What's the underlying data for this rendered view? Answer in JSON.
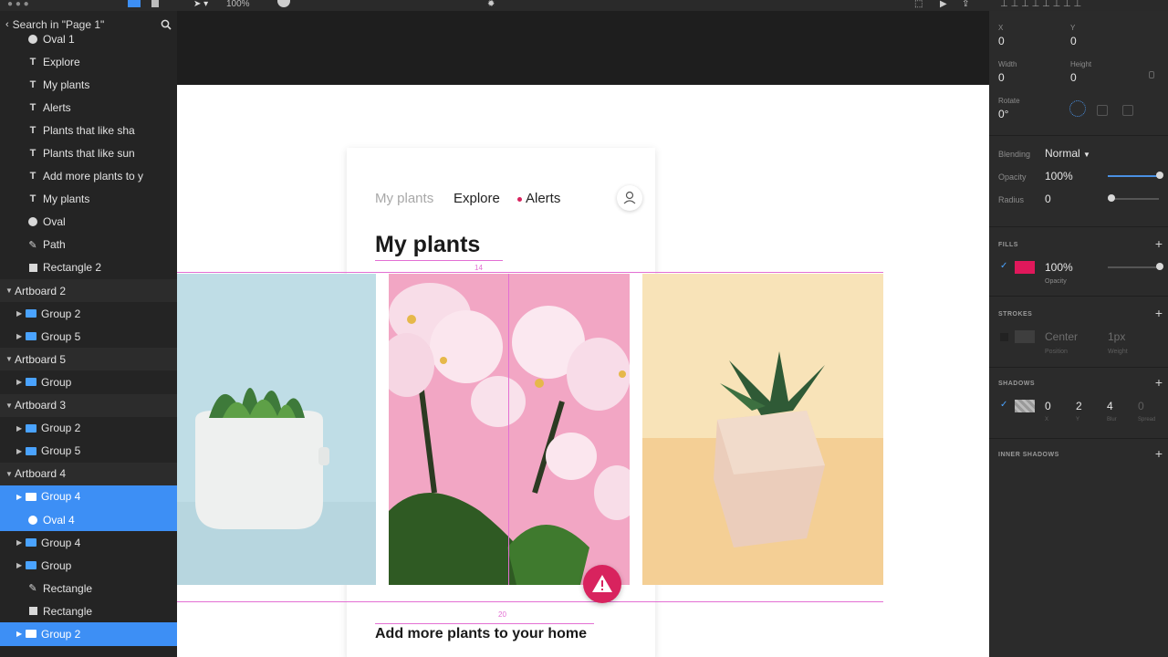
{
  "layers_panel": {
    "search_label": "Search in \"Page 1\"",
    "items": [
      {
        "label": "Oval 1",
        "type": "oval",
        "indent": 1
      },
      {
        "label": "Explore",
        "type": "text",
        "indent": 1
      },
      {
        "label": "My plants",
        "type": "text",
        "indent": 1
      },
      {
        "label": "Alerts",
        "type": "text",
        "indent": 1
      },
      {
        "label": "Plants that like sha",
        "type": "text",
        "indent": 1
      },
      {
        "label": "Plants that like sun",
        "type": "text",
        "indent": 1
      },
      {
        "label": "Add more plants to y",
        "type": "text",
        "indent": 1
      },
      {
        "label": "My plants",
        "type": "text",
        "indent": 1
      },
      {
        "label": "Oval",
        "type": "oval",
        "indent": 1
      },
      {
        "label": "Path",
        "type": "path",
        "indent": 1
      },
      {
        "label": "Rectangle 2",
        "type": "rect",
        "indent": 1
      },
      {
        "label": "Artboard 2",
        "type": "artboard",
        "indent": 0
      },
      {
        "label": "Group 2",
        "type": "group",
        "indent": 1
      },
      {
        "label": "Group 5",
        "type": "group",
        "indent": 1
      },
      {
        "label": "Artboard 5",
        "type": "artboard",
        "indent": 0
      },
      {
        "label": "Group",
        "type": "group",
        "indent": 1
      },
      {
        "label": "Artboard 3",
        "type": "artboard",
        "indent": 0
      },
      {
        "label": "Group 2",
        "type": "group",
        "indent": 1
      },
      {
        "label": "Group 5",
        "type": "group",
        "indent": 1
      },
      {
        "label": "Artboard 4",
        "type": "artboard",
        "indent": 0
      },
      {
        "label": "Group 4",
        "type": "group",
        "indent": 1,
        "selected": true
      },
      {
        "label": "Oval 4",
        "type": "oval",
        "indent": 1,
        "selected": true
      },
      {
        "label": "Group 4",
        "type": "group",
        "indent": 1
      },
      {
        "label": "Group",
        "type": "group",
        "indent": 1
      },
      {
        "label": "Rectangle",
        "type": "path",
        "indent": 1
      },
      {
        "label": "Rectangle",
        "type": "rect",
        "indent": 1
      },
      {
        "label": "Group 2",
        "type": "group",
        "indent": 1,
        "selected": true
      }
    ]
  },
  "toolbar": {
    "zoom": "100%"
  },
  "artboard": {
    "nav": {
      "my_plants": "My plants",
      "explore": "Explore",
      "alerts": "Alerts"
    },
    "title": "My plants",
    "subtitle": "Add more plants to your home",
    "measure_top": "14",
    "measure_bottom": "20"
  },
  "inspector": {
    "x_label": "X",
    "x_value": "0",
    "y_label": "Y",
    "y_value": "0",
    "width_label": "Width",
    "width_value": "0",
    "height_label": "Height",
    "height_value": "0",
    "rotate_label": "Rotate",
    "rotate_value": "0°",
    "blending_label": "Blending",
    "blending_value": "Normal",
    "opacity_label": "Opacity",
    "opacity_value": "100%",
    "radius_label": "Radius",
    "radius_value": "0",
    "fills_header": "FILLS",
    "fill_opacity": "100%",
    "fill_opacity_label": "Opacity",
    "fill_color": "#e0185b",
    "strokes_header": "STROKES",
    "stroke_position": "Center",
    "stroke_position_label": "Position",
    "stroke_weight": "1px",
    "stroke_weight_label": "Weight",
    "shadows_header": "SHADOWS",
    "shadow_x": "0",
    "shadow_y": "2",
    "shadow_blur": "4",
    "shadow_spread": "0",
    "shadow_x_label": "X",
    "shadow_y_label": "Y",
    "shadow_blur_label": "Blur",
    "shadow_spread_label": "Spread",
    "inner_shadows_header": "INNER SHADOWS"
  },
  "colors": {
    "accent_pink": "#d8235e",
    "selection_blue": "#3d8ff5",
    "guide_magenta": "#e36fd3"
  }
}
